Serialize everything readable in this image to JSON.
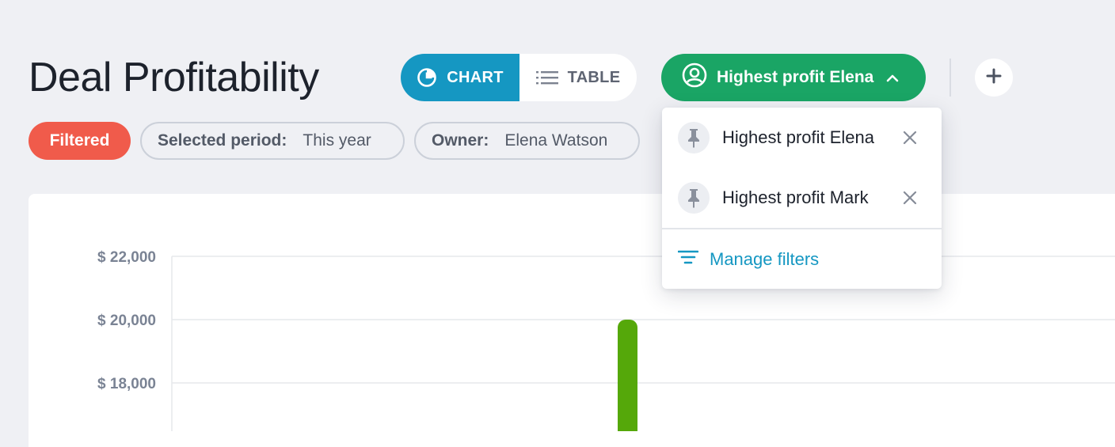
{
  "page": {
    "title": "Deal Profitability"
  },
  "view_toggle": {
    "chart_label": "CHART",
    "table_label": "TABLE",
    "active": "chart"
  },
  "filter_selector": {
    "label": "Highest profit Elena"
  },
  "chips": {
    "status": "Filtered",
    "period_key": "Selected period:",
    "period_value": "This year",
    "owner_key": "Owner:",
    "owner_value": "Elena Watson"
  },
  "dropdown": {
    "items": [
      {
        "label": "Highest profit Elena",
        "icon": "pin-icon"
      },
      {
        "label": "Highest profit Mark",
        "icon": "pin-icon"
      }
    ],
    "manage_label": "Manage filters"
  },
  "colors": {
    "accent_blue": "#1597c2",
    "accent_green": "#1aa565",
    "filtered_red": "#f05b4b",
    "bar_green": "#55a80a"
  },
  "chart_data": {
    "type": "bar",
    "y_ticks": [
      "$ 22,000",
      "$ 20,000",
      "$ 18,000"
    ],
    "y_tick_values": [
      22000,
      20000,
      18000
    ],
    "ylim": [
      17000,
      22000
    ],
    "series": [
      {
        "values": [
          20000
        ]
      }
    ],
    "grid": true
  }
}
